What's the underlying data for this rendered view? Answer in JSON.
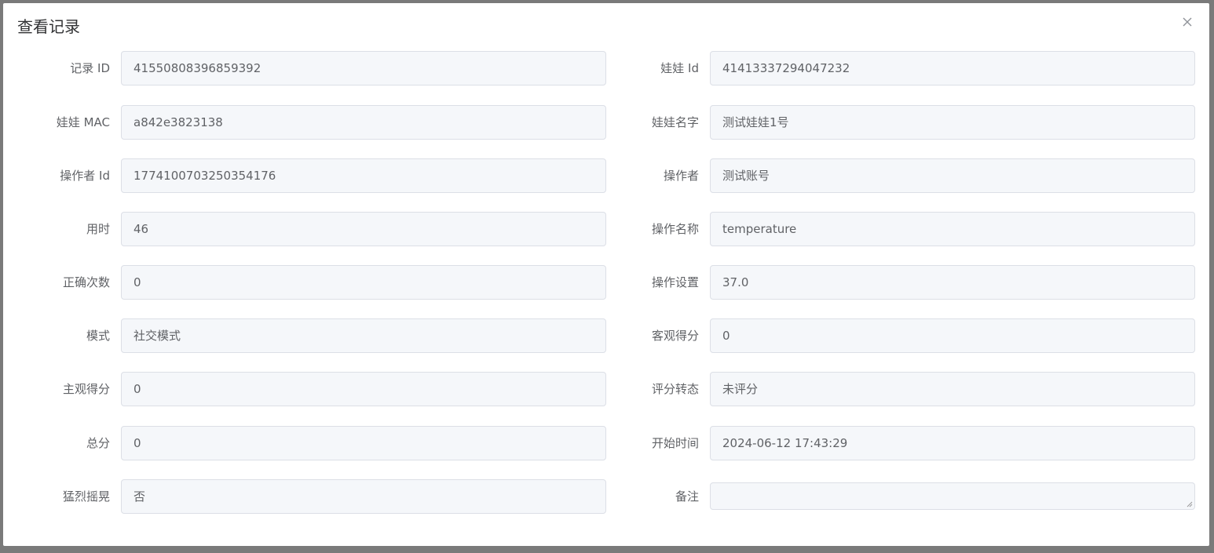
{
  "dialog": {
    "title": "查看记录",
    "close_icon": "close-icon"
  },
  "fields": [
    {
      "left_label": "记录 ID",
      "left_value": "41550808396859392",
      "right_label": "娃娃 Id",
      "right_value": "41413337294047232"
    },
    {
      "left_label": "娃娃 MAC",
      "left_value": "a842e3823138",
      "right_label": "娃娃名字",
      "right_value": "测试娃娃1号"
    },
    {
      "left_label": "操作者 Id",
      "left_value": "1774100703250354176",
      "right_label": "操作者",
      "right_value": "测试账号"
    },
    {
      "left_label": "用时",
      "left_value": "46",
      "right_label": "操作名称",
      "right_value": "temperature"
    },
    {
      "left_label": "正确次数",
      "left_value": "0",
      "right_label": "操作设置",
      "right_value": "37.0"
    },
    {
      "left_label": "模式",
      "left_value": "社交模式",
      "right_label": "客观得分",
      "right_value": "0"
    },
    {
      "left_label": "主观得分",
      "left_value": "0",
      "right_label": "评分转态",
      "right_value": "未评分"
    },
    {
      "left_label": "总分",
      "left_value": "0",
      "right_label": "开始时间",
      "right_value": "2024-06-12 17:43:29"
    },
    {
      "left_label": "猛烈摇晃",
      "left_value": "否",
      "right_label": "备注",
      "right_value": ""
    }
  ]
}
